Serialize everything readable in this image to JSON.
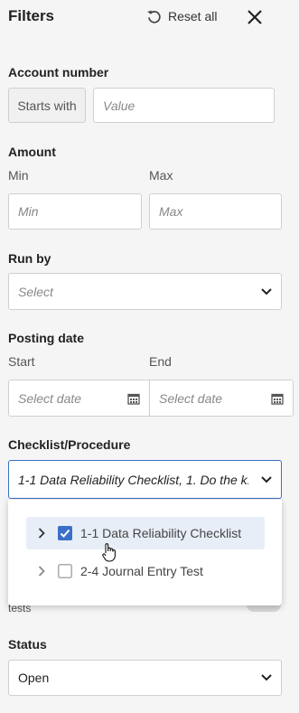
{
  "header": {
    "title": "Filters",
    "reset_label": "Reset all"
  },
  "account": {
    "label": "Account number",
    "prefix": "Starts with",
    "placeholder": "Value"
  },
  "amount": {
    "label": "Amount",
    "min_label": "Min",
    "max_label": "Max",
    "min_placeholder": "Min",
    "max_placeholder": "Max"
  },
  "runby": {
    "label": "Run by",
    "placeholder": "Select"
  },
  "posting": {
    "label": "Posting date",
    "start_label": "Start",
    "end_label": "End",
    "start_placeholder": "Select date",
    "end_placeholder": "Select date"
  },
  "checklist": {
    "label": "Checklist/Procedure",
    "value": "1-1 Data Reliability Checklist, 1. Do the k...",
    "options": [
      {
        "label": "1-1 Data Reliability Checklist",
        "checked": true
      },
      {
        "label": "2-4 Journal Entry Test",
        "checked": false
      }
    ]
  },
  "hidden_toggle": {
    "partial_label": "tests"
  },
  "status": {
    "label": "Status",
    "value": "Open"
  },
  "colors": {
    "accent": "#3b6fc9",
    "selected_bg": "#e8eef8"
  }
}
